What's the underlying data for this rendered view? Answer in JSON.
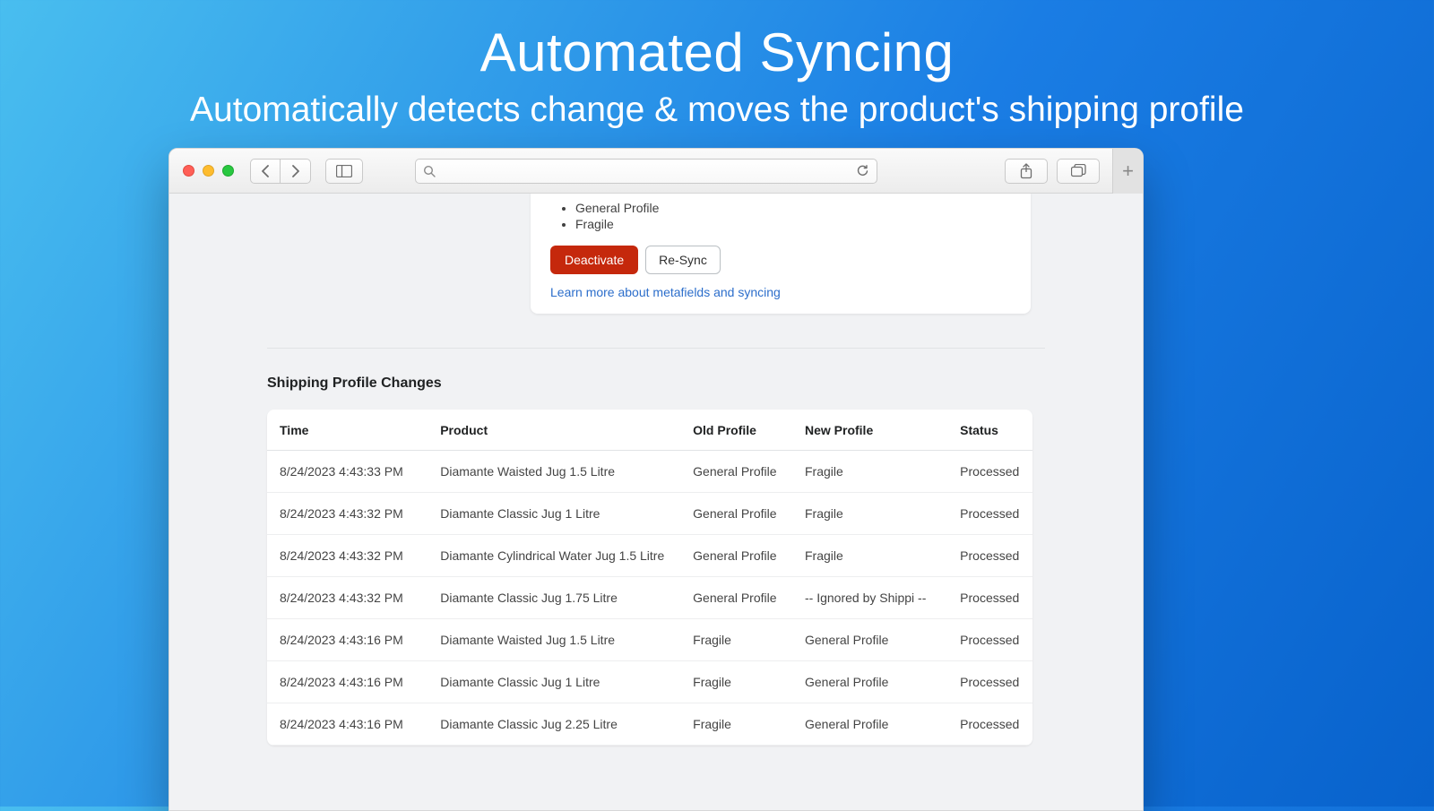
{
  "hero": {
    "title": "Automated Syncing",
    "subtitle": "Automatically detects change & moves the product's shipping profile"
  },
  "card": {
    "bullets": [
      "General Profile",
      "Fragile"
    ],
    "deactivate_label": "Deactivate",
    "resync_label": "Re-Sync",
    "learn_more_label": "Learn more about metafields and syncing"
  },
  "section_title": "Shipping Profile Changes",
  "table": {
    "headers": {
      "time": "Time",
      "product": "Product",
      "old_profile": "Old Profile",
      "new_profile": "New Profile",
      "status": "Status"
    },
    "rows": [
      {
        "time": "8/24/2023 4:43:33 PM",
        "product": "Diamante Waisted Jug 1.5 Litre",
        "old": "General Profile",
        "new": "Fragile",
        "status": "Processed"
      },
      {
        "time": "8/24/2023 4:43:32 PM",
        "product": "Diamante Classic Jug 1 Litre",
        "old": "General Profile",
        "new": "Fragile",
        "status": "Processed"
      },
      {
        "time": "8/24/2023 4:43:32 PM",
        "product": "Diamante Cylindrical Water Jug 1.5 Litre",
        "old": "General Profile",
        "new": "Fragile",
        "status": "Processed"
      },
      {
        "time": "8/24/2023 4:43:32 PM",
        "product": "Diamante Classic Jug 1.75 Litre",
        "old": "General Profile",
        "new": "-- Ignored by Shippi --",
        "status": "Processed"
      },
      {
        "time": "8/24/2023 4:43:16 PM",
        "product": "Diamante Waisted Jug 1.5 Litre",
        "old": "Fragile",
        "new": "General Profile",
        "status": "Processed"
      },
      {
        "time": "8/24/2023 4:43:16 PM",
        "product": "Diamante Classic Jug 1 Litre",
        "old": "Fragile",
        "new": "General Profile",
        "status": "Processed"
      },
      {
        "time": "8/24/2023 4:43:16 PM",
        "product": "Diamante Classic Jug 2.25 Litre",
        "old": "Fragile",
        "new": "General Profile",
        "status": "Processed"
      }
    ]
  }
}
